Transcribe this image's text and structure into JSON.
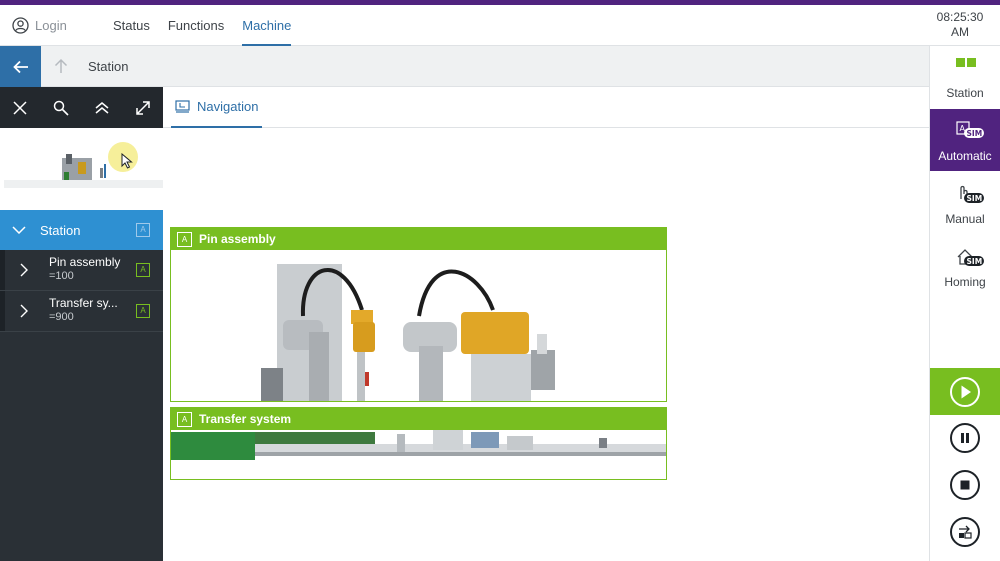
{
  "topbar": {
    "login_label": "Login",
    "menu": [
      "Status",
      "Functions",
      "Machine"
    ],
    "active_menu": "Machine",
    "clock_time": "08:25:30",
    "clock_period": "AM"
  },
  "secondary_bar": {
    "title": "Station"
  },
  "tabs": {
    "navigation_label": "Navigation"
  },
  "tree": {
    "root_label": "Station",
    "items": [
      {
        "name": "Pin assembly",
        "value": "=100"
      },
      {
        "name": "Transfer sy...",
        "value": "=900"
      }
    ]
  },
  "panels": [
    {
      "title": "Pin assembly"
    },
    {
      "title": "Transfer system"
    }
  ],
  "sidebar": {
    "station_label": "Station",
    "automatic_label": "Automatic",
    "manual_label": "Manual",
    "homing_label": "Homing",
    "sim_badge": "SIM"
  },
  "colors": {
    "brand_purple": "#50237f",
    "accent_blue": "#2e6fa7",
    "selection_blue": "#2e90d2",
    "panel_green": "#78be20",
    "dark_panel": "#2a3036"
  },
  "icons": [
    "user-icon",
    "back-arrow-icon",
    "up-arrow-icon",
    "close-icon",
    "search-icon",
    "collapse-all-icon",
    "expand-icon",
    "navigation-icon",
    "chevron-down-icon",
    "chevron-right-icon",
    "auto-badge-icon",
    "station-grid-icon",
    "automatic-sim-icon",
    "manual-sim-icon",
    "homing-sim-icon",
    "play-icon",
    "pause-icon",
    "stop-icon",
    "step-icon"
  ]
}
